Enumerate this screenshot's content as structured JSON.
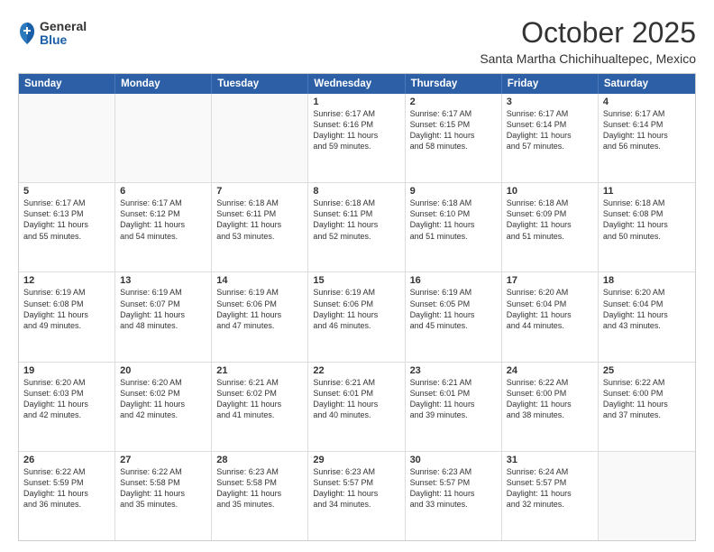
{
  "logo": {
    "general": "General",
    "blue": "Blue"
  },
  "title": "October 2025",
  "location": "Santa Martha Chichihualtepec, Mexico",
  "days_of_week": [
    "Sunday",
    "Monday",
    "Tuesday",
    "Wednesday",
    "Thursday",
    "Friday",
    "Saturday"
  ],
  "weeks": [
    [
      {
        "day": "",
        "info": ""
      },
      {
        "day": "",
        "info": ""
      },
      {
        "day": "",
        "info": ""
      },
      {
        "day": "1",
        "info": "Sunrise: 6:17 AM\nSunset: 6:16 PM\nDaylight: 11 hours\nand 59 minutes."
      },
      {
        "day": "2",
        "info": "Sunrise: 6:17 AM\nSunset: 6:15 PM\nDaylight: 11 hours\nand 58 minutes."
      },
      {
        "day": "3",
        "info": "Sunrise: 6:17 AM\nSunset: 6:14 PM\nDaylight: 11 hours\nand 57 minutes."
      },
      {
        "day": "4",
        "info": "Sunrise: 6:17 AM\nSunset: 6:14 PM\nDaylight: 11 hours\nand 56 minutes."
      }
    ],
    [
      {
        "day": "5",
        "info": "Sunrise: 6:17 AM\nSunset: 6:13 PM\nDaylight: 11 hours\nand 55 minutes."
      },
      {
        "day": "6",
        "info": "Sunrise: 6:17 AM\nSunset: 6:12 PM\nDaylight: 11 hours\nand 54 minutes."
      },
      {
        "day": "7",
        "info": "Sunrise: 6:18 AM\nSunset: 6:11 PM\nDaylight: 11 hours\nand 53 minutes."
      },
      {
        "day": "8",
        "info": "Sunrise: 6:18 AM\nSunset: 6:11 PM\nDaylight: 11 hours\nand 52 minutes."
      },
      {
        "day": "9",
        "info": "Sunrise: 6:18 AM\nSunset: 6:10 PM\nDaylight: 11 hours\nand 51 minutes."
      },
      {
        "day": "10",
        "info": "Sunrise: 6:18 AM\nSunset: 6:09 PM\nDaylight: 11 hours\nand 51 minutes."
      },
      {
        "day": "11",
        "info": "Sunrise: 6:18 AM\nSunset: 6:08 PM\nDaylight: 11 hours\nand 50 minutes."
      }
    ],
    [
      {
        "day": "12",
        "info": "Sunrise: 6:19 AM\nSunset: 6:08 PM\nDaylight: 11 hours\nand 49 minutes."
      },
      {
        "day": "13",
        "info": "Sunrise: 6:19 AM\nSunset: 6:07 PM\nDaylight: 11 hours\nand 48 minutes."
      },
      {
        "day": "14",
        "info": "Sunrise: 6:19 AM\nSunset: 6:06 PM\nDaylight: 11 hours\nand 47 minutes."
      },
      {
        "day": "15",
        "info": "Sunrise: 6:19 AM\nSunset: 6:06 PM\nDaylight: 11 hours\nand 46 minutes."
      },
      {
        "day": "16",
        "info": "Sunrise: 6:19 AM\nSunset: 6:05 PM\nDaylight: 11 hours\nand 45 minutes."
      },
      {
        "day": "17",
        "info": "Sunrise: 6:20 AM\nSunset: 6:04 PM\nDaylight: 11 hours\nand 44 minutes."
      },
      {
        "day": "18",
        "info": "Sunrise: 6:20 AM\nSunset: 6:04 PM\nDaylight: 11 hours\nand 43 minutes."
      }
    ],
    [
      {
        "day": "19",
        "info": "Sunrise: 6:20 AM\nSunset: 6:03 PM\nDaylight: 11 hours\nand 42 minutes."
      },
      {
        "day": "20",
        "info": "Sunrise: 6:20 AM\nSunset: 6:02 PM\nDaylight: 11 hours\nand 42 minutes."
      },
      {
        "day": "21",
        "info": "Sunrise: 6:21 AM\nSunset: 6:02 PM\nDaylight: 11 hours\nand 41 minutes."
      },
      {
        "day": "22",
        "info": "Sunrise: 6:21 AM\nSunset: 6:01 PM\nDaylight: 11 hours\nand 40 minutes."
      },
      {
        "day": "23",
        "info": "Sunrise: 6:21 AM\nSunset: 6:01 PM\nDaylight: 11 hours\nand 39 minutes."
      },
      {
        "day": "24",
        "info": "Sunrise: 6:22 AM\nSunset: 6:00 PM\nDaylight: 11 hours\nand 38 minutes."
      },
      {
        "day": "25",
        "info": "Sunrise: 6:22 AM\nSunset: 6:00 PM\nDaylight: 11 hours\nand 37 minutes."
      }
    ],
    [
      {
        "day": "26",
        "info": "Sunrise: 6:22 AM\nSunset: 5:59 PM\nDaylight: 11 hours\nand 36 minutes."
      },
      {
        "day": "27",
        "info": "Sunrise: 6:22 AM\nSunset: 5:58 PM\nDaylight: 11 hours\nand 35 minutes."
      },
      {
        "day": "28",
        "info": "Sunrise: 6:23 AM\nSunset: 5:58 PM\nDaylight: 11 hours\nand 35 minutes."
      },
      {
        "day": "29",
        "info": "Sunrise: 6:23 AM\nSunset: 5:57 PM\nDaylight: 11 hours\nand 34 minutes."
      },
      {
        "day": "30",
        "info": "Sunrise: 6:23 AM\nSunset: 5:57 PM\nDaylight: 11 hours\nand 33 minutes."
      },
      {
        "day": "31",
        "info": "Sunrise: 6:24 AM\nSunset: 5:57 PM\nDaylight: 11 hours\nand 32 minutes."
      },
      {
        "day": "",
        "info": ""
      }
    ]
  ]
}
